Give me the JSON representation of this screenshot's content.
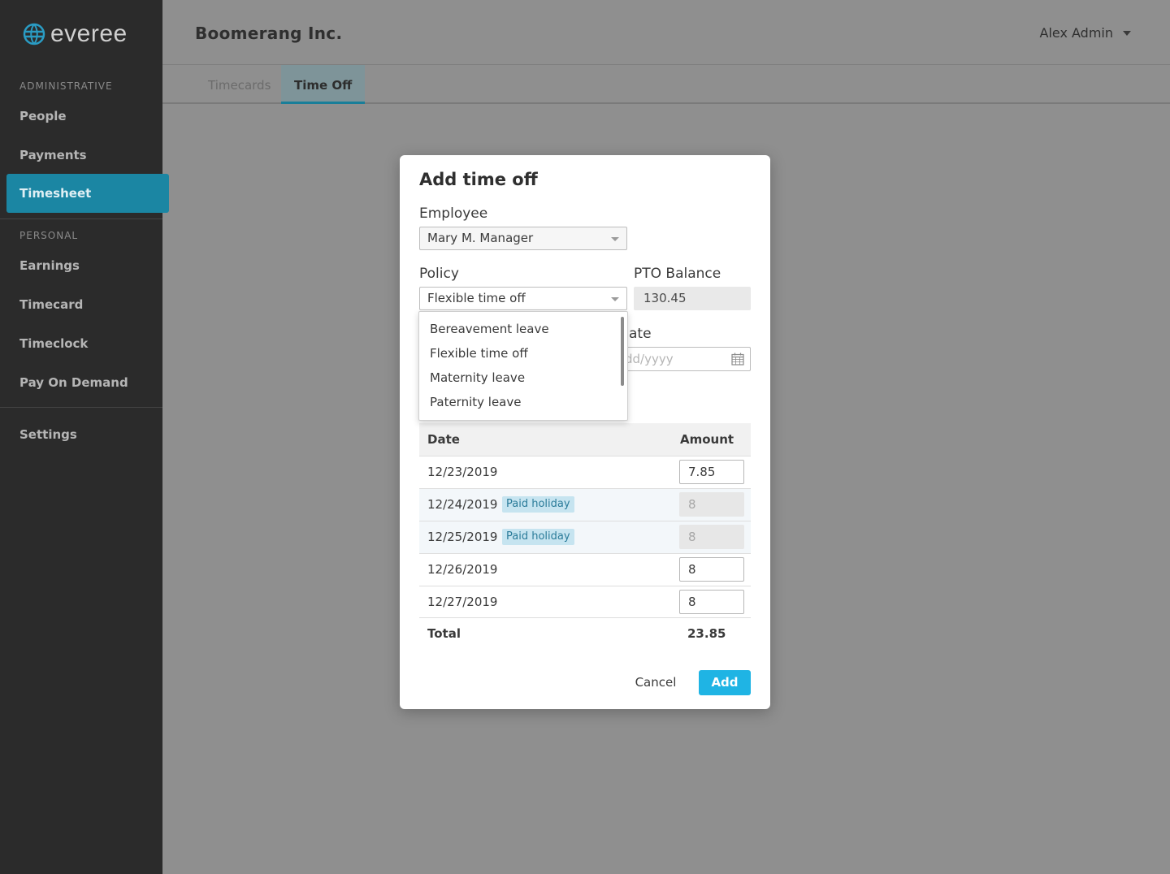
{
  "app": {
    "logo_text": "everee"
  },
  "sidebar": {
    "administrative_label": "ADMINISTRATIVE",
    "personal_label": "PERSONAL",
    "admin_items": [
      {
        "label": "People"
      },
      {
        "label": "Payments"
      },
      {
        "label": "Timesheet",
        "active": true
      }
    ],
    "personal_items": [
      {
        "label": "Earnings"
      },
      {
        "label": "Timecard"
      },
      {
        "label": "Timeclock"
      },
      {
        "label": "Pay On Demand"
      }
    ],
    "settings_label": "Settings"
  },
  "header": {
    "company": "Boomerang Inc.",
    "user": "Alex Admin"
  },
  "tabs": [
    {
      "label": "Timecards",
      "active": false
    },
    {
      "label": "Time Off",
      "active": true
    }
  ],
  "modal": {
    "title": "Add time off",
    "employee_label": "Employee",
    "employee_value": "Mary M. Manager",
    "policy_label": "Policy",
    "policy_value": "Flexible time off",
    "pto_label": "PTO Balance",
    "pto_value": "130.45",
    "date_label_partial": "ate",
    "date_placeholder_partial": "dd/yyyy",
    "policy_options": [
      "Bereavement leave",
      "Flexible time off",
      "Maternity leave",
      "Paternity leave"
    ],
    "table": {
      "date_header": "Date",
      "amount_header": "Amount",
      "rows": [
        {
          "date": "12/23/2019",
          "badge": "",
          "amount": "7.85",
          "editable": true
        },
        {
          "date": "12/24/2019",
          "badge": "Paid holiday",
          "amount": "8",
          "editable": false
        },
        {
          "date": "12/25/2019",
          "badge": "Paid holiday",
          "amount": "8",
          "editable": false
        },
        {
          "date": "12/26/2019",
          "badge": "",
          "amount": "8",
          "editable": true
        },
        {
          "date": "12/27/2019",
          "badge": "",
          "amount": "8",
          "editable": true
        }
      ],
      "total_label": "Total",
      "total_value": "23.85"
    },
    "cancel_label": "Cancel",
    "add_label": "Add"
  },
  "colors": {
    "sidebar_bg": "#2b2b2b",
    "active_nav": "#1b86a3",
    "primary_button": "#1fb4e4",
    "badge_bg": "#c6e4f0",
    "overlay_bg": "#8f8f8f"
  }
}
